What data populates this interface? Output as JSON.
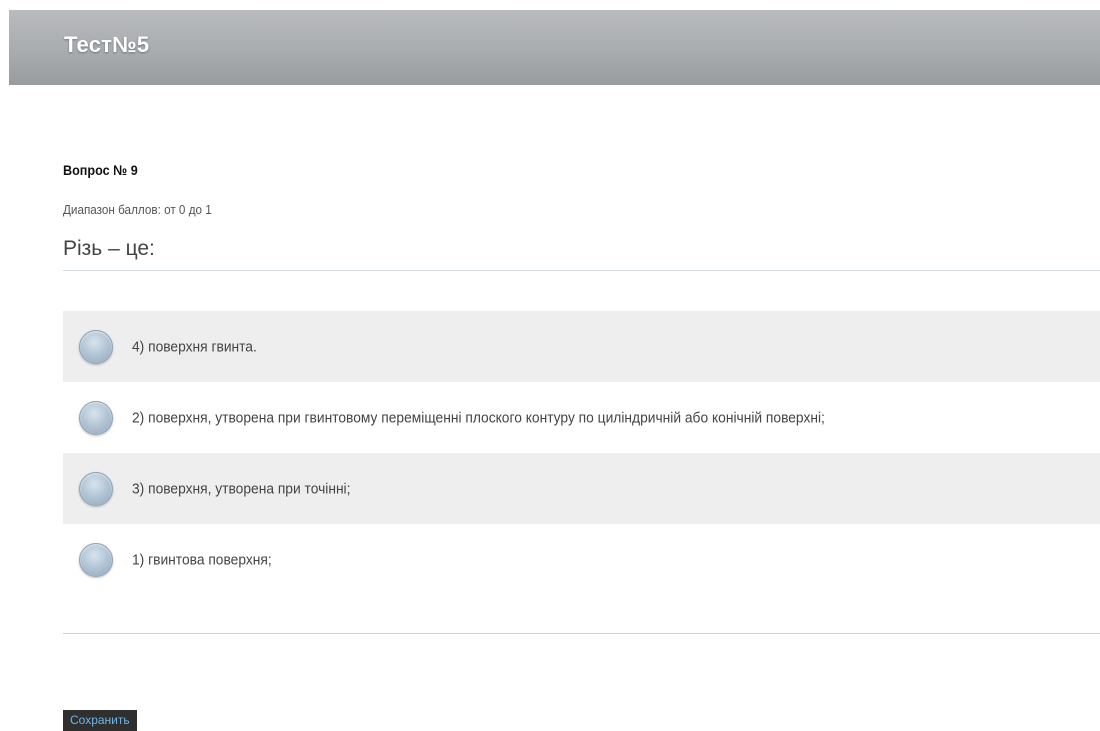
{
  "header": {
    "title": "Тест№5"
  },
  "question": {
    "number_label": "Вопрос № 9",
    "score_range": "Диапазон баллов: от 0 до 1",
    "text": "Різь – це:"
  },
  "answers": [
    {
      "label": "4) поверхня гвинта.",
      "selected": false
    },
    {
      "label": "2) поверхня, утворена при гвинтовому переміщенні плоского контуру по циліндричній або конічній поверхні;",
      "selected": false
    },
    {
      "label": "3) поверхня, утворена при точінні;",
      "selected": false
    },
    {
      "label": "1) гвинтова поверхня;",
      "selected": false
    }
  ],
  "actions": {
    "save_label": "Сохранить"
  },
  "colors": {
    "header_bg": "#a9acaf",
    "answer_shaded_bg": "#eeeeee",
    "save_button_bg": "#2f2f2f",
    "save_button_text": "#6fb6e6"
  }
}
